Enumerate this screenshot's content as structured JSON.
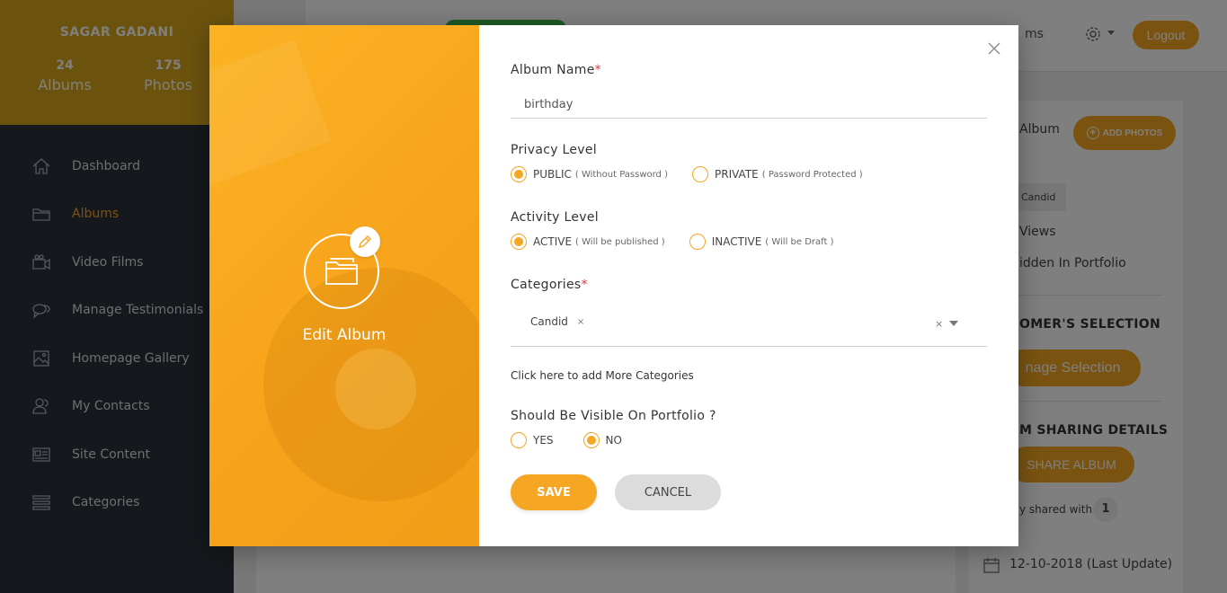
{
  "sidebar": {
    "user_name": "SAGAR GADANI",
    "albums_count": "24",
    "albums_label": "Albums",
    "photos_count": "175",
    "photos_label": "Photos",
    "items": [
      {
        "label": "Dashboard",
        "icon": "home-icon"
      },
      {
        "label": "Albums",
        "icon": "folder-icon",
        "active": true
      },
      {
        "label": "Video Films",
        "icon": "video-camera-icon"
      },
      {
        "label": "Manage Testimonials",
        "icon": "chat-bubbles-icon"
      },
      {
        "label": "Homepage Gallery",
        "icon": "image-icon"
      },
      {
        "label": "My Contacts",
        "icon": "users-icon"
      },
      {
        "label": "Site Content",
        "icon": "newspaper-icon"
      },
      {
        "label": "Categories",
        "icon": "list-icon"
      }
    ]
  },
  "topbar": {
    "nav_text": "ms",
    "logout_label": "Logout"
  },
  "right_panel": {
    "album_label": "Album",
    "add_photos_label": "ADD PHOTOS",
    "tag_label": "Candid",
    "views_text": "Views",
    "hidden_text": "idden In Portfolio",
    "selection_heading": "OMER'S SELECTION",
    "selection_button": "nage Selection",
    "sharing_heading": "M SHARING DETAILS",
    "share_button": "SHARE ALBUM",
    "shared_with_text": "y shared with",
    "shared_count": "1",
    "last_update": "12-10-2018 (Last Update)"
  },
  "modal": {
    "title": "Edit Album",
    "album_name_label": "Album Name",
    "album_name_value": "birthday",
    "privacy_label": "Privacy Level",
    "privacy_public": "PUBLIC",
    "privacy_public_hint": "( Without Password )",
    "privacy_private": "PRIVATE",
    "privacy_private_hint": "( Password Protected )",
    "activity_label": "Activity Level",
    "activity_active": "ACTIVE",
    "activity_active_hint": "( Will be published )",
    "activity_inactive": "INACTIVE",
    "activity_inactive_hint": "( Will be Draft )",
    "categories_label": "Categories",
    "selected_category": "Candid",
    "chip_remove": "×",
    "clear_all": "×",
    "add_categories_link": "Click here to add More Categories",
    "portfolio_label": "Should Be Visible On Portfolio ?",
    "portfolio_yes": "YES",
    "portfolio_no": "NO",
    "save_label": "SAVE",
    "cancel_label": "CANCEL",
    "required_mark": "*"
  },
  "colors": {
    "accent": "#f5a623",
    "sidebar_bg": "#2b3138",
    "required": "#e53935"
  }
}
